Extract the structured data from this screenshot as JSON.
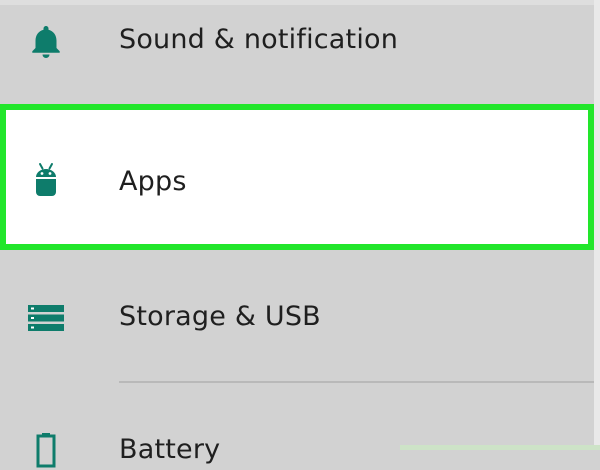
{
  "settings": {
    "items": [
      {
        "label": "Sound & notification",
        "icon": "bell-icon"
      },
      {
        "label": "Apps",
        "icon": "android-icon",
        "highlighted": true
      },
      {
        "label": "Storage & USB",
        "icon": "storage-icon"
      },
      {
        "label": "Battery",
        "icon": "battery-icon"
      }
    ]
  },
  "colors": {
    "accent": "#0e7c6b",
    "highlight_border": "#22e62b",
    "background": "#d2d2d2",
    "selected_background": "#ffffff"
  }
}
